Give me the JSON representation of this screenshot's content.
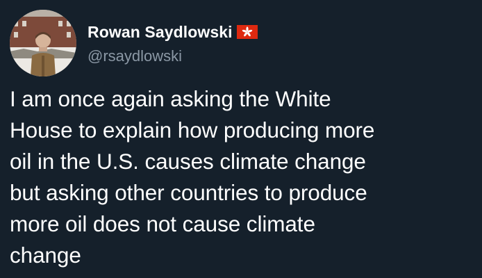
{
  "author": {
    "display_name": "Rowan Saydlowski",
    "handle": "@rsaydlowski",
    "flag_icon": "hong-kong-flag-icon"
  },
  "tweet": {
    "lines": [
      "I am once again asking the White",
      "House to explain how producing more",
      "oil in the U.S. causes climate change",
      "but asking other countries to produce",
      "more oil does not cause climate",
      "change"
    ]
  },
  "colors": {
    "background": "#15202b",
    "text": "#ffffff",
    "handle": "#8b98a5",
    "flag_red": "#de2910"
  }
}
